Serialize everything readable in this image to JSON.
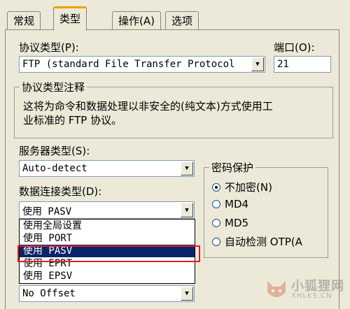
{
  "tabs": [
    {
      "label": "常规",
      "active": false
    },
    {
      "label": "类型",
      "active": true
    },
    {
      "label": "操作(A)",
      "active": false
    },
    {
      "label": "选项",
      "active": false
    }
  ],
  "protocol": {
    "label": "协议类型(P):",
    "value": "FTP (standard File Transfer Protocol"
  },
  "port": {
    "label": "端口(O):",
    "value": "21"
  },
  "protocol_note": {
    "legend": "协议类型注释",
    "text_line1": "这将为命令和数据处理以非安全的(纯文本)方式使用工",
    "text_line2": "业标准的 FTP 协议。"
  },
  "server_type": {
    "label": "服务器类型(S):",
    "value": "Auto-detect"
  },
  "data_connection": {
    "label": "数据连接类型(D):",
    "value": "使用 PASV",
    "options": [
      "使用全局设置",
      "使用 PORT",
      "使用 PASV",
      "使用 EPRT",
      "使用 EPSV"
    ],
    "selected_index": 2
  },
  "time_offset": {
    "value": "No Offset"
  },
  "password_protection": {
    "legend": "密码保护",
    "options": [
      {
        "label": "不加密(N)",
        "checked": true
      },
      {
        "label": "MD4",
        "checked": false
      },
      {
        "label": "MD5",
        "checked": false
      },
      {
        "label": "自动检测 OTP(A",
        "checked": false
      }
    ]
  },
  "watermark": {
    "cn": "小狐狸网",
    "en": "XHLKS.CN"
  },
  "colors": {
    "selection": "#0a246a",
    "highlight_box": "#e01f1f",
    "active_tab_accent": "#f0a000"
  }
}
